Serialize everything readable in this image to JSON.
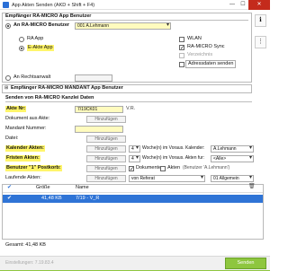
{
  "window": {
    "title": "App Akten Senden (AKD + Shift + F4)",
    "minimize": "—",
    "maximize": "☐",
    "close": "✕"
  },
  "recipient": {
    "group_title": "Empfänger RA-MICRO App Benutzer",
    "an_benutzer_label": "An RA-MICRO Benutzer",
    "benutzer_value": "001 A.Lehmann",
    "ra_app_label": "RA App",
    "eakte_app_label": "E-Akte App",
    "wlan_label": "WLAN",
    "sync_label": "RA-MICRO Sync",
    "verzeichnis_label": "Verzeichnis",
    "adressdaten_label": "Adressdaten senden",
    "an_rechtsanwalt_label": "An Rechtsanwalt",
    "mandant_label": "Empfänger RA-MICRO MANDANT App Benutzer"
  },
  "kanzlei": {
    "section_title": "Senden von RA-MICRO Kanzlei Daten",
    "akte_nr_label": "Akte Nr:",
    "akte_nr_value": "7/19CK01",
    "akte_suffix": "V.R.",
    "dokument_label": "Dokument aus Akte:",
    "mandant_nummer_label": "Mandant Nummer:",
    "datei_label": "Datei:",
    "kalender_label": "Kalender Akten:",
    "fristen_label": "Fristen Akten:",
    "benutzer_postkorb_label": "Benutzer \"1\" Postkorb:",
    "laufende_label": "Laufende Akten:",
    "add_button": "Hinzufügen",
    "weeks_value": "4",
    "wochen_kalender": "Woche(n) im Voraus. Kalender:",
    "wochen_fristen": "Woche(n) im Voraus. Akten fur:",
    "kalender_user": "A.Lehmann",
    "fristen_option": "<Alle>",
    "dokumente_label": "Dokumente",
    "akten_label": "Akten",
    "benutzer_hint": "(Benutzer 'A.Lehmann')",
    "laufende_referat": "von Referat",
    "laufende_allgemein": "01 Allgemein"
  },
  "filelist": {
    "col_size": "Größe",
    "col_name": "Name",
    "rows": [
      {
        "size": "41,48 KB",
        "name": "7/19 - V_R"
      }
    ]
  },
  "status": {
    "total": "Gesamt: 41,48 KB",
    "footer_text": "Einstellungen: 7.19.83.4",
    "send_label": "Senden"
  },
  "colors": {
    "accent": "#2f74d6",
    "send": "#8ec63f",
    "required": "#fffbbe",
    "highlight": "#fff56a"
  }
}
